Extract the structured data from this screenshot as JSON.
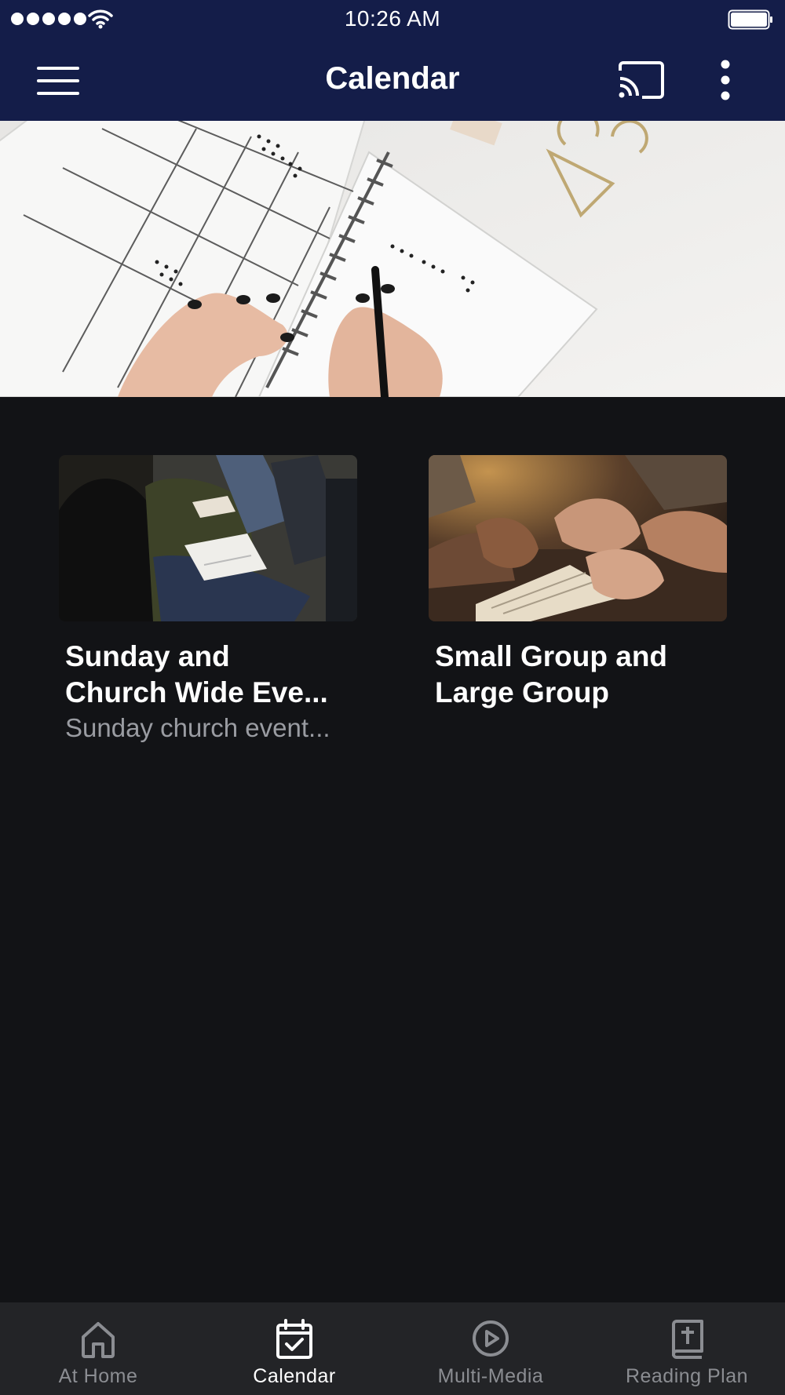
{
  "status_bar": {
    "time": "10:26 AM"
  },
  "app_bar": {
    "title": "Calendar",
    "icons": [
      "menu-icon",
      "cast-icon",
      "more-vert-icon"
    ]
  },
  "hero": {
    "image": "calendar-planner-photo"
  },
  "cards": [
    {
      "title_line1": "Sunday and",
      "title_line2": "Church Wide Eve...",
      "subtitle": "Sunday church event...",
      "image": "congregation-seated-photo"
    },
    {
      "title_line1": "Small Group and",
      "title_line2": "Large Group",
      "image": "praying-hands-bible-photo"
    }
  ],
  "tab_bar": {
    "items": [
      {
        "label": "At Home",
        "icon": "home-icon",
        "active": false
      },
      {
        "label": "Calendar",
        "icon": "calendar-check-icon",
        "active": true
      },
      {
        "label": "Multi-Media",
        "icon": "play-circle-icon",
        "active": false
      },
      {
        "label": "Reading Plan",
        "icon": "bible-icon",
        "active": false
      }
    ]
  },
  "colors": {
    "header_bg": "#141d49",
    "page_bg": "#121316",
    "tab_bar_bg": "#232427",
    "tab_inactive": "#8b8d92",
    "subtitle": "#9a9ca2"
  }
}
